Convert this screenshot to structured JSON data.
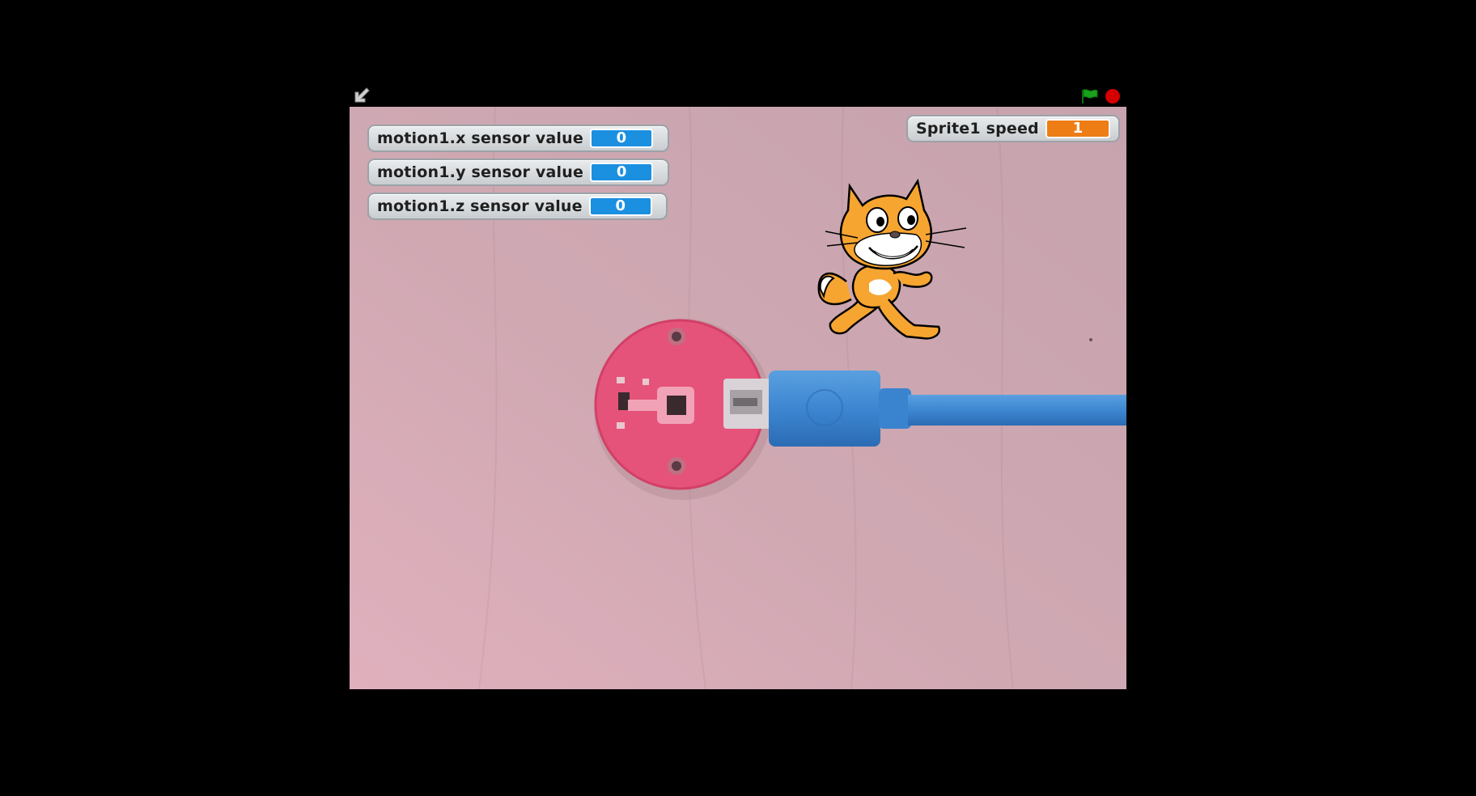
{
  "toolbar": {
    "exit_icon": "exit-fullscreen-arrow-icon",
    "flag_icon": "green-flag-icon",
    "stop_icon": "stop-sign-icon"
  },
  "colors": {
    "background": "#000000",
    "stage_tint": "#d8a8b4",
    "sensor_monitor_value": "#1b8fe0",
    "variable_monitor_value": "#ee7d16",
    "stop": "#d40000",
    "flag": "#19a11b"
  },
  "monitors": [
    {
      "label": "motion1.x sensor value",
      "value": "0"
    },
    {
      "label": "motion1.y sensor value",
      "value": "0"
    },
    {
      "label": "motion1.z sensor value",
      "value": "0"
    },
    {
      "label": "Sprite1 speed",
      "value": "1"
    }
  ],
  "stage": {
    "backdrop": "video-feed",
    "sprite": "scratch-cat"
  }
}
